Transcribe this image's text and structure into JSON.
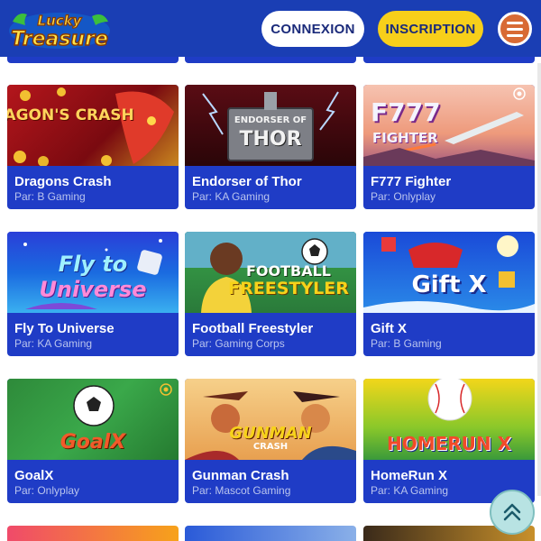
{
  "header": {
    "logo_line1": "Lucky",
    "logo_line2": "Treasure",
    "connexion_label": "CONNEXION",
    "inscription_label": "INSCRIPTION",
    "menu_icon": "hamburger-icon"
  },
  "provider_prefix": "Par:",
  "games": [
    {
      "title": "Dragons Crash",
      "provider": "Par: B Gaming",
      "art": "DRAGON'S CRASH"
    },
    {
      "title": "Endorser of Thor",
      "provider": "Par: KA Gaming",
      "art_line1": "ENDORSER OF",
      "art_line2": "THOR"
    },
    {
      "title": "F777 Fighter",
      "provider": "Par: Onlyplay",
      "art_line1": "F777",
      "art_line2": "FIGHTER"
    },
    {
      "title": "Fly To Universe",
      "provider": "Par: KA Gaming",
      "art_line1": "Fly to",
      "art_line2": "Universe"
    },
    {
      "title": "Football Freestyler",
      "provider": "Par: Gaming Corps",
      "art_line1": "FOOTBALL",
      "art_line2": "FREESTYLER"
    },
    {
      "title": "Gift X",
      "provider": "Par: B Gaming",
      "art": "Gift X"
    },
    {
      "title": "GoalX",
      "provider": "Par: Onlyplay",
      "art": "GoalX"
    },
    {
      "title": "Gunman Crash",
      "provider": "Par: Mascot Gaming",
      "art_line1": "GUNMAN",
      "art_line2": "CRASH"
    },
    {
      "title": "HomeRun X",
      "provider": "Par: KA Gaming",
      "art": "HOMERUN X"
    }
  ],
  "colors": {
    "header_bg": "#1a3eb4",
    "card_bg": "#1f3cc6",
    "inscription_bg": "#f7cf1a",
    "menu_bg": "#d86a35"
  },
  "scroll_top_icon": "double-chevron-up-icon"
}
